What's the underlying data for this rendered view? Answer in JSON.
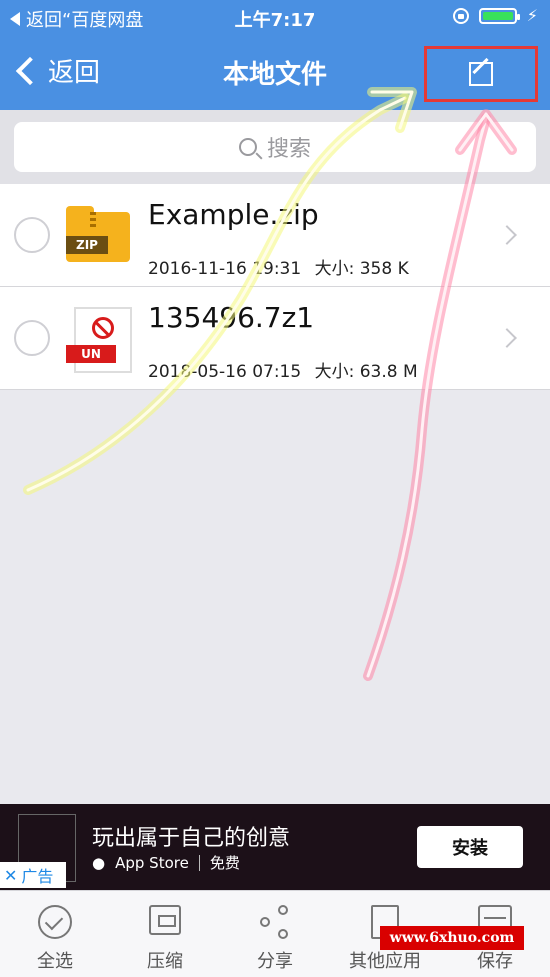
{
  "status_bar": {
    "back_app": "返回“百度网盘",
    "time": "上午7:17"
  },
  "nav": {
    "back_label": "返回",
    "title": "本地文件"
  },
  "search": {
    "placeholder": "搜索"
  },
  "files": [
    {
      "name": "Example.zip",
      "date": "2016-11-16 19:31",
      "size": "大小: 358 K",
      "badge": "ZIP"
    },
    {
      "name": "135496.7z1",
      "date": "2018-05-16 07:15",
      "size": "大小: 63.8 M",
      "badge": "UN"
    }
  ],
  "ad": {
    "headline": "玩出属于自己的创意",
    "store": "App Store",
    "price": "免费",
    "install": "安装",
    "tag": "广告"
  },
  "toolbar": {
    "select_all": "全选",
    "compress": "压缩",
    "share": "分享",
    "other_apps": "其他应用",
    "save": "保存"
  },
  "watermark": "www.6xhuo.com",
  "colors": {
    "nav_blue": "#4a90e2",
    "highlight_red": "#e53935",
    "arrow_yellow": "#f4f77a",
    "arrow_pink": "#ff86a8"
  }
}
